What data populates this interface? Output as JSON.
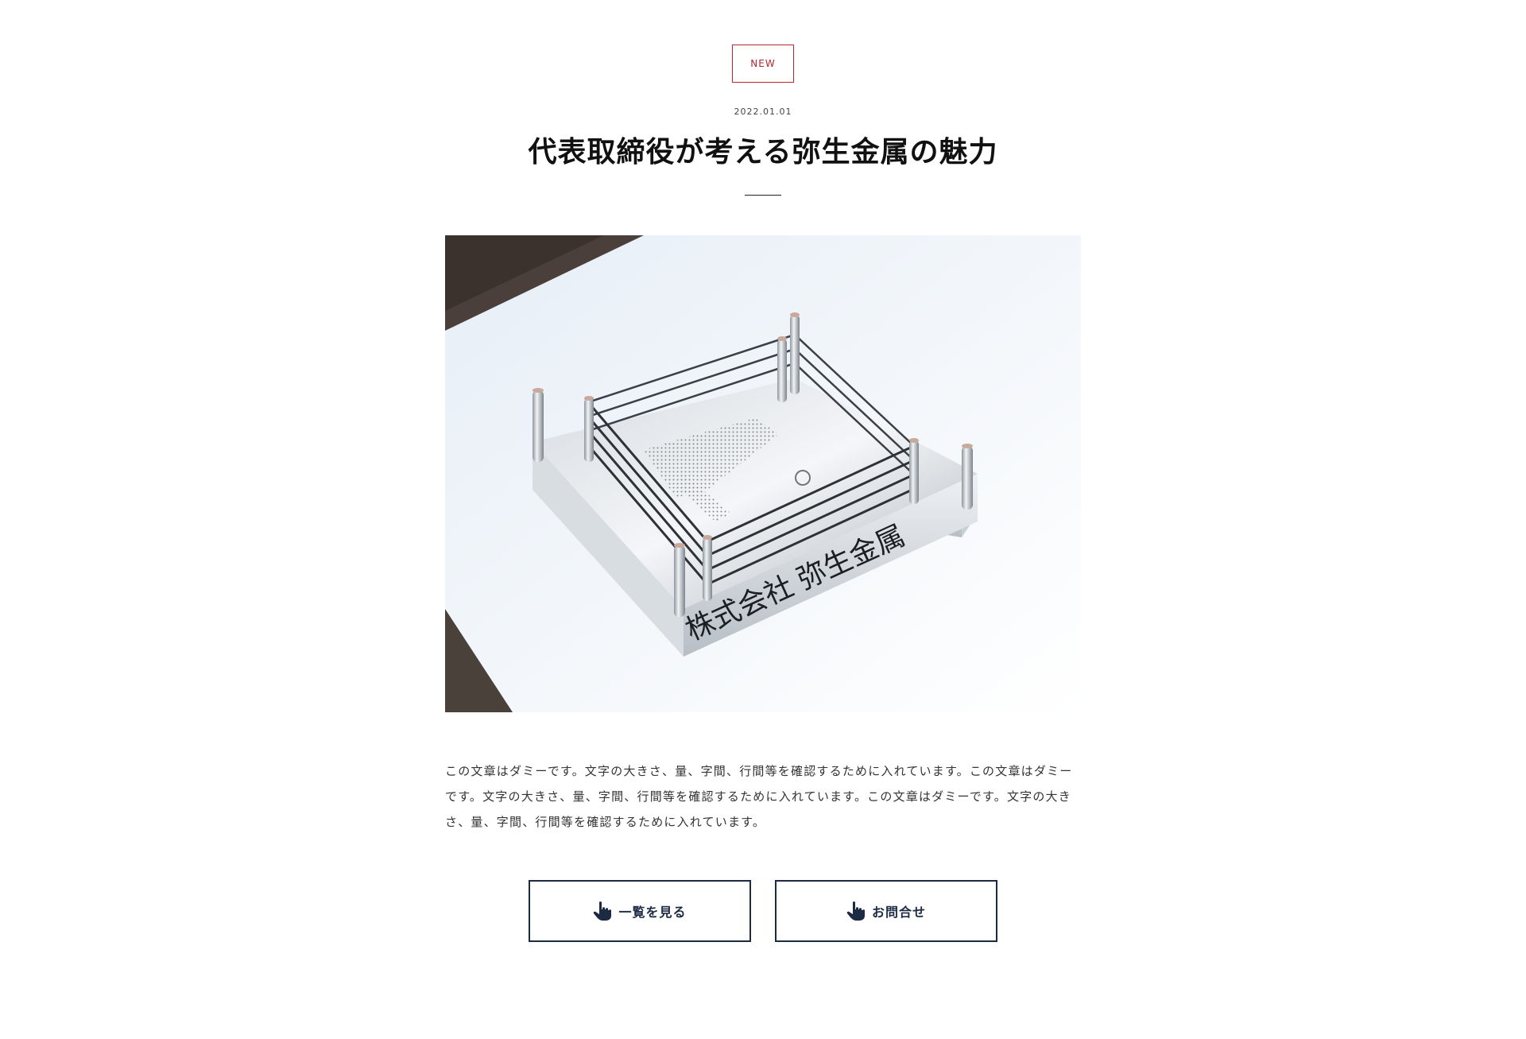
{
  "badge": "NEW",
  "date": "2022.01.01",
  "title": "代表取締役が考える弥生金属の魅力",
  "photo": {
    "plate_text": "株式会社 弥生金属"
  },
  "body": "この文章はダミーです。文字の大きさ、量、字間、行間等を確認するために入れています。この文章はダミーです。文字の大きさ、量、字間、行間等を確認するために入れています。この文章はダミーです。文字の大きさ、量、字間、行間等を確認するために入れています。",
  "buttons": {
    "list_label": "一覧を見る",
    "contact_label": "お問合せ"
  },
  "colors": {
    "accent": "#b3262e",
    "button": "#1c2a44"
  },
  "icons": {
    "button": "hand-pointer-icon"
  }
}
